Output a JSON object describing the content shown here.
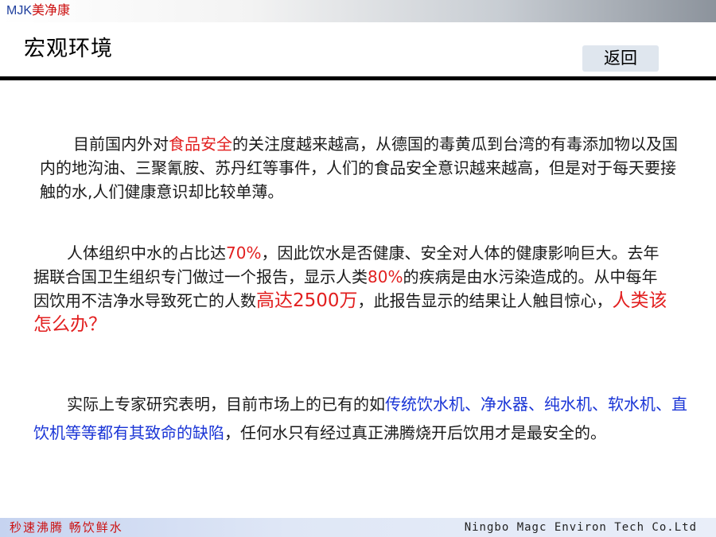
{
  "header": {
    "brand_latin": "MJK",
    "brand_cn": "美净康",
    "title": "宏观环境",
    "back_label": "返回"
  },
  "paragraphs": {
    "p1": {
      "t1": "目前国内外对",
      "h1": "食品安全",
      "t2": "的关注度越来越高，从德国的毒黄瓜到台湾的有毒添加物以及国内的地沟油、三聚氰胺、苏丹红等事件，人们的食品安全意识越来越高，但是对于每天要接触的水,人们健康意识却比较单薄。"
    },
    "p2": {
      "t1": "人体组织中水的占比达",
      "h1": "70%",
      "t2": "，因此饮水是否健康、安全对人体的健康影响巨大。去年据联合国卫生组织专门做过一个报告，显示人类",
      "h2": "80%",
      "t3": "的疾病是由水污染造成的。从中每年因饮用不洁净水导致死亡的人数",
      "h3": "高达2500万",
      "t4": "，此报告显示的结果让人触目惊心，",
      "h4": "人类该怎么办？"
    },
    "p3": {
      "t1": "实际上专家研究表明，目前市场上的已有的如",
      "h1": "传统饮水机、净水器、纯水机、软水机、直饮机等等都有其致命的缺陷",
      "t2": "，任何水只有经过真正沸腾烧开后饮用才是最安全的。"
    }
  },
  "footer": {
    "slogan": "秒速沸腾  畅饮鲜水",
    "company": "Ningbo Magc Environ Tech Co.Ltd"
  },
  "colors": {
    "highlight_red": "#e21f1f",
    "highlight_blue": "#1a35d6",
    "rule": "#000000"
  }
}
